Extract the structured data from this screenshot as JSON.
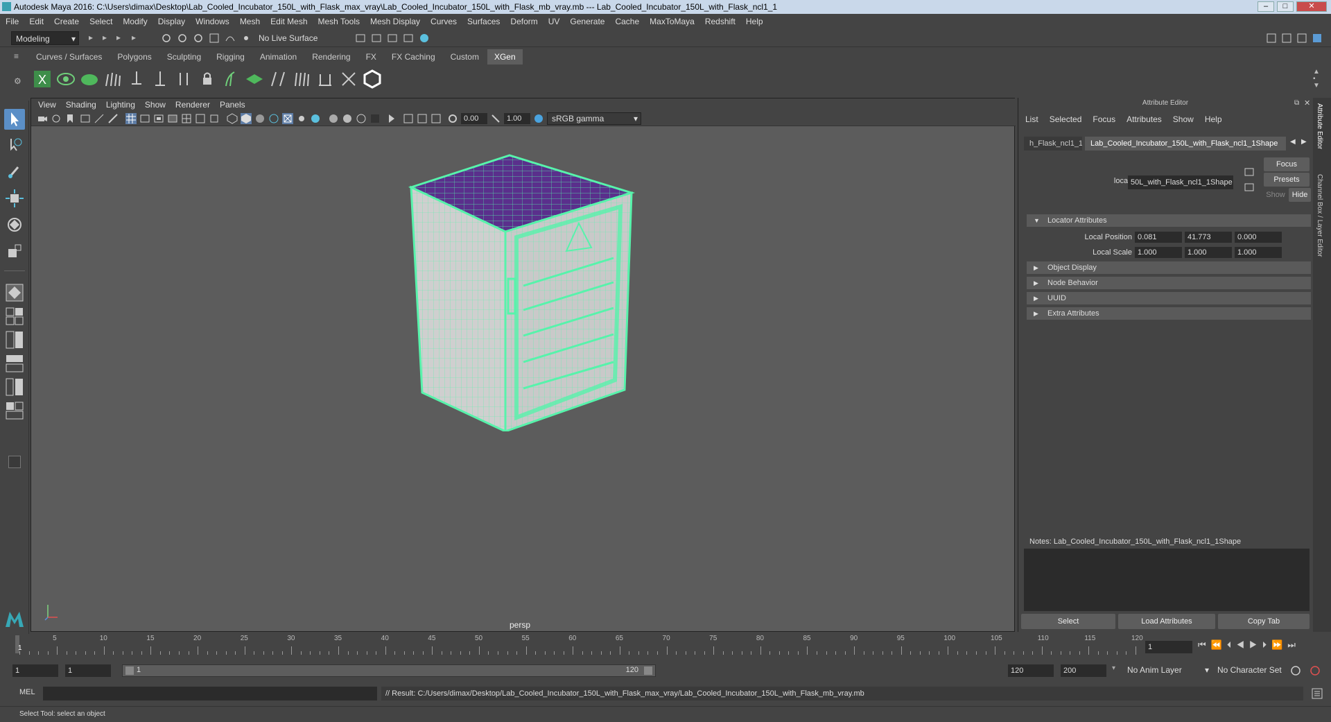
{
  "window": {
    "title": "Autodesk Maya 2016: C:\\Users\\dimax\\Desktop\\Lab_Cooled_Incubator_150L_with_Flask_max_vray\\Lab_Cooled_Incubator_150L_with_Flask_mb_vray.mb   ---   Lab_Cooled_Incubator_150L_with_Flask_ncl1_1"
  },
  "menubar": [
    "File",
    "Edit",
    "Create",
    "Select",
    "Modify",
    "Display",
    "Windows",
    "Mesh",
    "Edit Mesh",
    "Mesh Tools",
    "Mesh Display",
    "Curves",
    "Surfaces",
    "Deform",
    "UV",
    "Generate",
    "Cache",
    "MaxToMaya",
    "Redshift",
    "Help"
  ],
  "statusline": {
    "mode": "Modeling",
    "live_surface": "No Live Surface"
  },
  "shelf_tabs": [
    {
      "label": "Curves / Surfaces",
      "active": false
    },
    {
      "label": "Polygons",
      "active": false
    },
    {
      "label": "Sculpting",
      "active": false
    },
    {
      "label": "Rigging",
      "active": false
    },
    {
      "label": "Animation",
      "active": false
    },
    {
      "label": "Rendering",
      "active": false
    },
    {
      "label": "FX",
      "active": false
    },
    {
      "label": "FX Caching",
      "active": false
    },
    {
      "label": "Custom",
      "active": false
    },
    {
      "label": "XGen",
      "active": true
    }
  ],
  "viewport": {
    "menu": [
      "View",
      "Shading",
      "Lighting",
      "Show",
      "Renderer",
      "Panels"
    ],
    "exposure": "0.00",
    "gamma": "1.00",
    "color_space": "sRGB gamma",
    "camera": "persp"
  },
  "attribute_editor": {
    "title": "Attribute Editor",
    "menu": [
      "List",
      "Selected",
      "Focus",
      "Attributes",
      "Show",
      "Help"
    ],
    "node_tabs": [
      "h_Flask_ncl1_1",
      "Lab_Cooled_Incubator_150L_with_Flask_ncl1_1Shape"
    ],
    "locator_label": "locator:",
    "locator_value": "50L_with_Flask_ncl1_1Shape",
    "focus": "Focus",
    "presets": "Presets",
    "show": "Show",
    "hide": "Hide",
    "sections": {
      "locator_attributes": "Locator Attributes",
      "object_display": "Object Display",
      "node_behavior": "Node Behavior",
      "uuid": "UUID",
      "extra_attributes": "Extra Attributes"
    },
    "local_position_label": "Local Position",
    "local_position": [
      "0.081",
      "41.773",
      "0.000"
    ],
    "local_scale_label": "Local Scale",
    "local_scale": [
      "1.000",
      "1.000",
      "1.000"
    ],
    "notes": "Notes:  Lab_Cooled_Incubator_150L_with_Flask_ncl1_1Shape",
    "buttons": [
      "Select",
      "Load Attributes",
      "Copy Tab"
    ]
  },
  "side_tabs": [
    "Attribute Editor",
    "Channel Box / Layer Editor"
  ],
  "timeline": {
    "ticks": [
      5,
      10,
      15,
      20,
      25,
      30,
      35,
      40,
      45,
      50,
      55,
      60,
      65,
      70,
      75,
      80,
      85,
      90,
      95,
      100,
      105,
      110,
      115,
      120
    ],
    "start": 1,
    "end": 120,
    "current_frame": "1",
    "current_marker": "1"
  },
  "range": {
    "start": "1",
    "start2": "1",
    "slider_start": "1",
    "slider_end": "120",
    "end": "120",
    "end2": "200",
    "anim_layer": "No Anim Layer",
    "char_set": "No Character Set"
  },
  "command": {
    "lang": "MEL",
    "result": "// Result: C:/Users/dimax/Desktop/Lab_Cooled_Incubator_150L_with_Flask_max_vray/Lab_Cooled_Incubator_150L_with_Flask_mb_vray.mb"
  },
  "helpline": "Select Tool: select an object",
  "colors": {
    "wire": "#57f3ab",
    "top_purple": "#5a2f8c",
    "viewport_bg": "#5c5c5c",
    "panel": "#444444"
  }
}
